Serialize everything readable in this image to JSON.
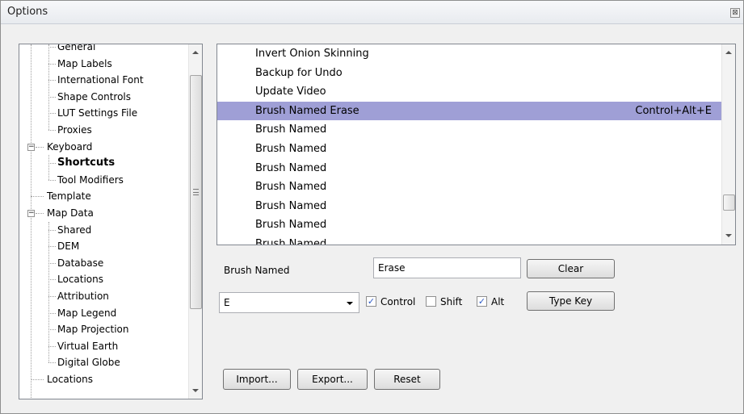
{
  "window": {
    "title": "Options",
    "close_glyph": "⊠"
  },
  "tree": {
    "items": [
      {
        "label": "General",
        "level": 2
      },
      {
        "label": "Map Labels",
        "level": 2
      },
      {
        "label": "International Font",
        "level": 2
      },
      {
        "label": "Shape Controls",
        "level": 2
      },
      {
        "label": "LUT Settings File",
        "level": 2
      },
      {
        "label": "Proxies",
        "level": 2
      },
      {
        "label": "Keyboard",
        "level": 1,
        "expander": "−"
      },
      {
        "label": "Shortcuts",
        "level": 2,
        "selected": true
      },
      {
        "label": "Tool Modifiers",
        "level": 2
      },
      {
        "label": "Template",
        "level": 1
      },
      {
        "label": "Map Data",
        "level": 1,
        "expander": "−"
      },
      {
        "label": "Shared",
        "level": 2
      },
      {
        "label": "DEM",
        "level": 2
      },
      {
        "label": "Database",
        "level": 2
      },
      {
        "label": "Locations",
        "level": 2
      },
      {
        "label": "Attribution",
        "level": 2
      },
      {
        "label": "Map Legend",
        "level": 2
      },
      {
        "label": "Map Projection",
        "level": 2
      },
      {
        "label": "Virtual Earth",
        "level": 2
      },
      {
        "label": "Digital Globe",
        "level": 2
      },
      {
        "label": "Locations",
        "level": 1
      }
    ]
  },
  "shortcut_list": {
    "rows": [
      {
        "name": "Invert Onion Skinning",
        "key": ""
      },
      {
        "name": "Backup for Undo",
        "key": ""
      },
      {
        "name": "Update Video",
        "key": ""
      },
      {
        "name": "Brush Named Erase",
        "key": "Control+Alt+E",
        "selected": true
      },
      {
        "name": "Brush Named",
        "key": ""
      },
      {
        "name": "Brush Named",
        "key": ""
      },
      {
        "name": "Brush Named",
        "key": ""
      },
      {
        "name": "Brush Named",
        "key": ""
      },
      {
        "name": "Brush Named",
        "key": ""
      },
      {
        "name": "Brush Named",
        "key": ""
      },
      {
        "name": "Brush Named",
        "key": ""
      }
    ]
  },
  "editor": {
    "command_label": "Brush Named",
    "argument_value": "Erase",
    "clear_label": "Clear",
    "key_value": "E",
    "control_label": "Control",
    "control_checked": true,
    "shift_label": "Shift",
    "shift_checked": false,
    "alt_label": "Alt",
    "alt_checked": true,
    "type_key_label": "Type Key",
    "check_glyph": "✓"
  },
  "footer": {
    "import_label": "Import...",
    "export_label": "Export...",
    "reset_label": "Reset"
  }
}
